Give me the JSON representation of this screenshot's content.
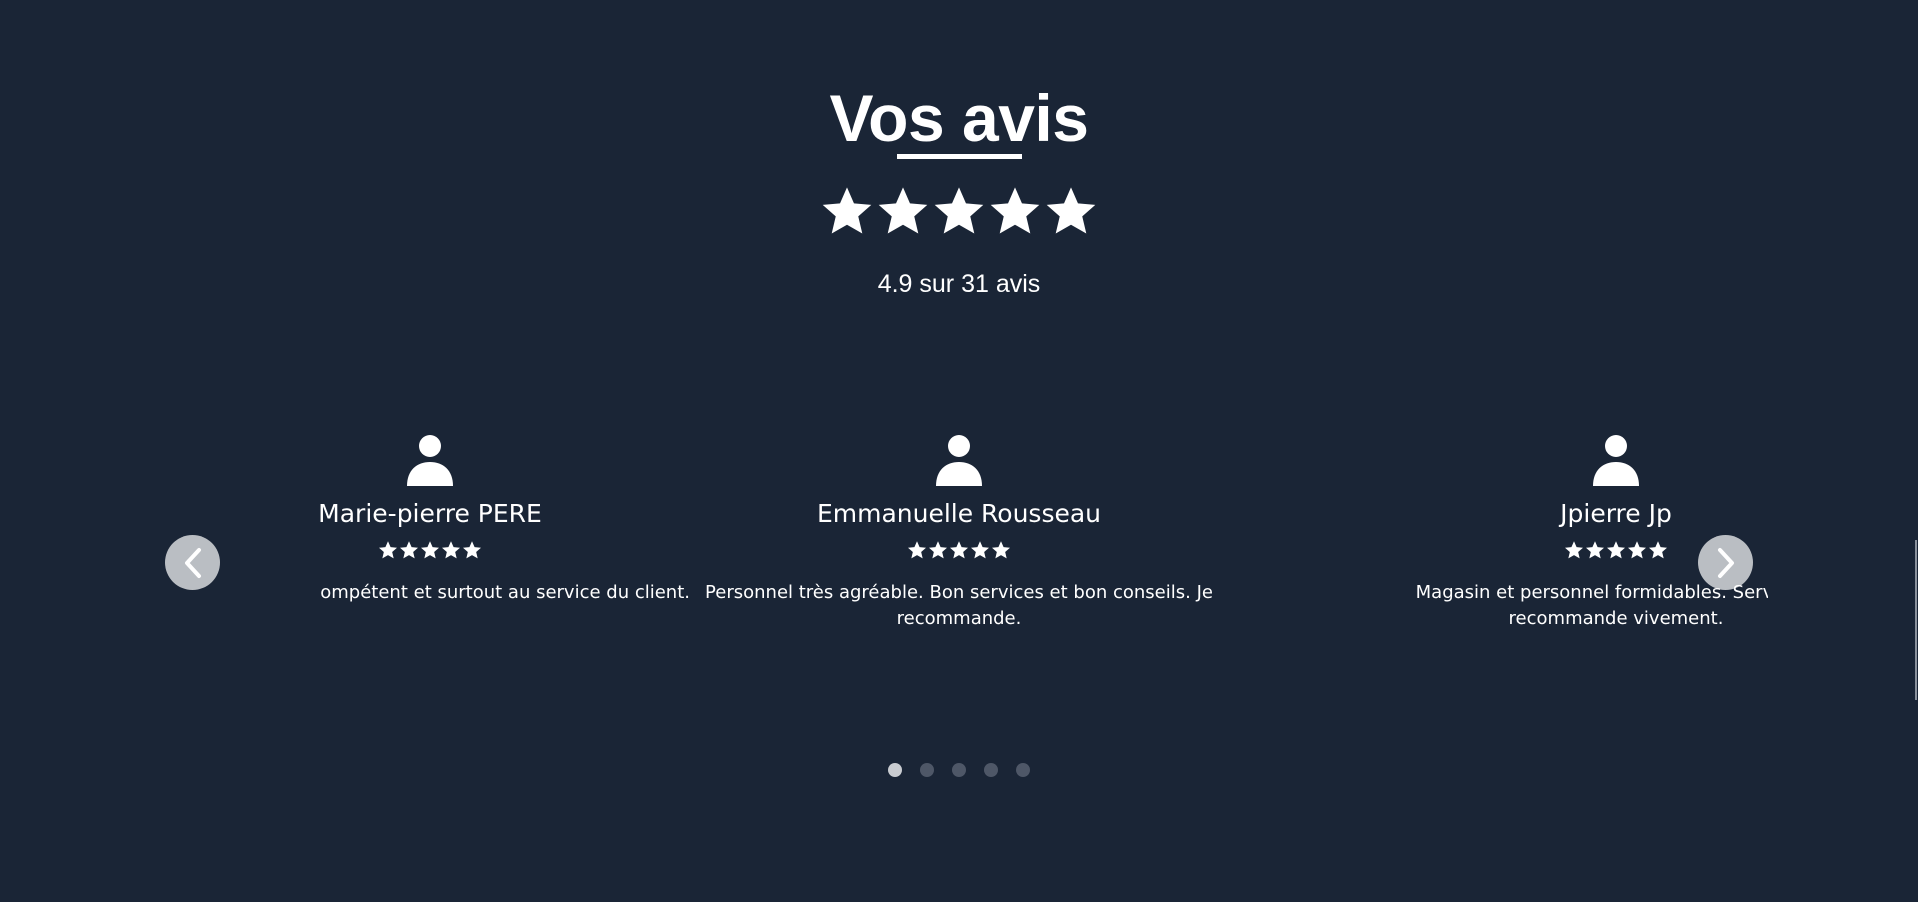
{
  "section": {
    "title": "Vos avis",
    "rating_stars": 5,
    "summary": "4.9 sur 31 avis"
  },
  "reviews": [
    {
      "name": "Marie-pierre PERE",
      "stars": 5,
      "text": "ompétent et surtout au service du client."
    },
    {
      "name": "Emmanuelle Rousseau",
      "stars": 5,
      "text": "Personnel très agréable. Bon services et bon conseils. Je recommande."
    },
    {
      "name": "Jpierre Jp",
      "stars": 5,
      "text": "Magasin et personnel formidables. Service p recommande vivement."
    }
  ],
  "carousel": {
    "prev_icon": "chevron-left-icon",
    "next_icon": "chevron-right-icon",
    "pages": 5,
    "active_page": 1
  },
  "colors": {
    "background": "#1a2536",
    "text": "#ffffff",
    "dot_active": "#c9ccd1",
    "dot_inactive": "#4e5767"
  }
}
